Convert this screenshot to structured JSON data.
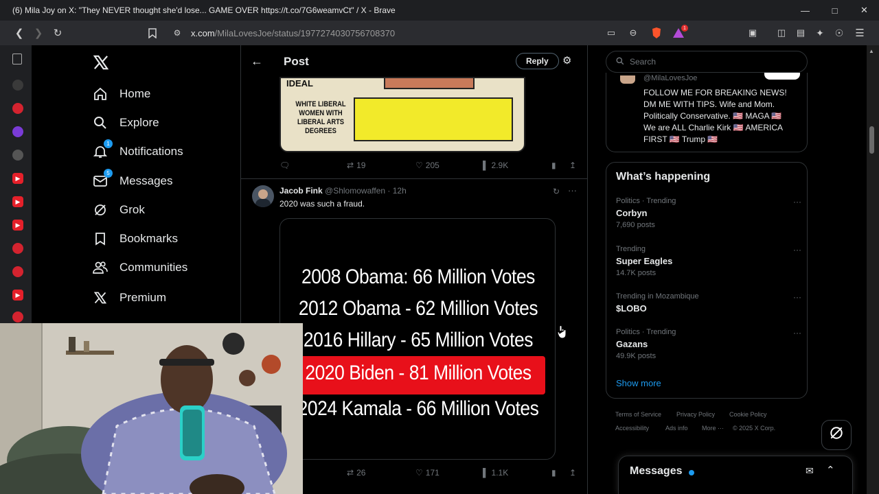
{
  "browser": {
    "window_title": "(6) Mila Joy on X: \"They NEVER thought she'd lose... GAME OVER https://t.co/7G6weamvCt\" / X - Brave",
    "url_host": "x.com",
    "url_path": "/MilaLovesJoe/status/1977274030756708370",
    "shield_badge": "1"
  },
  "nav": {
    "items": [
      {
        "label": "Home",
        "icon": "home-icon"
      },
      {
        "label": "Explore",
        "icon": "search-icon"
      },
      {
        "label": "Notifications",
        "icon": "bell-icon",
        "badge": "1"
      },
      {
        "label": "Messages",
        "icon": "mail-icon",
        "badge": "5"
      },
      {
        "label": "Grok",
        "icon": "grok-icon"
      },
      {
        "label": "Bookmarks",
        "icon": "bookmark-icon"
      },
      {
        "label": "Communities",
        "icon": "people-icon"
      },
      {
        "label": "Premium",
        "icon": "x-logo-icon"
      }
    ]
  },
  "post": {
    "header_title": "Post",
    "reply_label": "Reply",
    "comic": {
      "partial_text": "IDEAL",
      "label": "WHITE LIBERAL WOMEN WITH LIBERAL ARTS DEGREES"
    },
    "stats": {
      "replies": "",
      "reposts": "19",
      "likes": "205",
      "views": "2.9K"
    }
  },
  "reply": {
    "author_name": "Jacob Fink",
    "author_handle": "@Shlomowaffen",
    "time": "12h",
    "text": "2020 was such a fraud.",
    "image_lines": [
      "2008 Obama: 66 Million Votes",
      "2012 Obama - 62 Million Votes",
      "2016 Hillary - 65 Million Votes",
      "2020 Biden - 81 Million Votes",
      "2024 Kamala - 66 Million Votes"
    ],
    "stats": {
      "reposts": "26",
      "likes": "171",
      "views": "1.1K"
    }
  },
  "right": {
    "search_placeholder": "Search",
    "bio": {
      "handle": "@MilaLovesJoe",
      "lines": [
        "FOLLOW ME FOR BREAKING NEWS!",
        "DM ME WITH TIPS. Wife and Mom.",
        "Politically Conservative. 🇺🇸 MAGA 🇺🇸",
        "We are ALL Charlie Kirk 🇺🇸 AMERICA",
        "FIRST 🇺🇸 Trump 🇺🇸"
      ]
    },
    "happening": {
      "title": "What’s happening",
      "trends": [
        {
          "meta": "Politics · Trending",
          "name": "Corbyn",
          "count": "7,690 posts"
        },
        {
          "meta": "Trending",
          "name": "Super Eagles",
          "count": "14.7K posts"
        },
        {
          "meta": "Trending in Mozambique",
          "name": "$LOBO",
          "count": ""
        },
        {
          "meta": "Politics · Trending",
          "name": "Gazans",
          "count": "49.9K posts"
        }
      ],
      "show_more": "Show more"
    },
    "footer": {
      "terms": "Terms of Service",
      "privacy": "Privacy Policy",
      "cookie": "Cookie Policy",
      "accessibility": "Accessibility",
      "ads": "Ads info",
      "more": "More ···",
      "copyright": "© 2025 X Corp."
    },
    "messages_drawer": "Messages"
  },
  "colors": {
    "accent": "#1d9bf0",
    "highlight_red": "#e8101a",
    "comic_yellow": "#f2ea2a"
  }
}
